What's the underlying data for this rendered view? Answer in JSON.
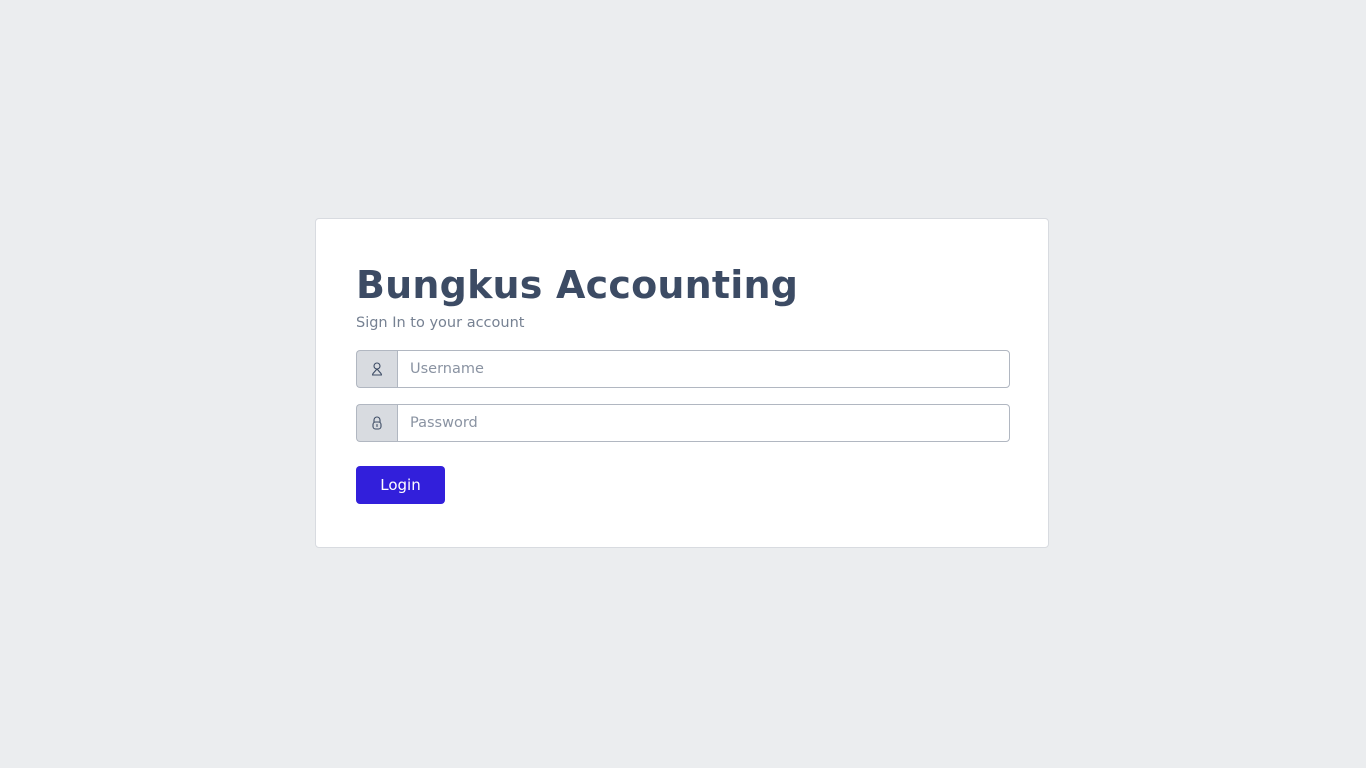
{
  "login_card": {
    "title": "Bungkus Accounting",
    "subtitle": "Sign In to your account",
    "username": {
      "icon": "user-icon",
      "placeholder": "Username",
      "value": ""
    },
    "password": {
      "icon": "lock-icon",
      "placeholder": "Password",
      "value": ""
    },
    "login_label": "Login"
  },
  "colors": {
    "background": "#ebedef",
    "card": "#ffffff",
    "title_text": "#3c4b64",
    "muted_text": "#768192",
    "addon_bg": "#d8dbe0",
    "primary": "#321fdb"
  }
}
